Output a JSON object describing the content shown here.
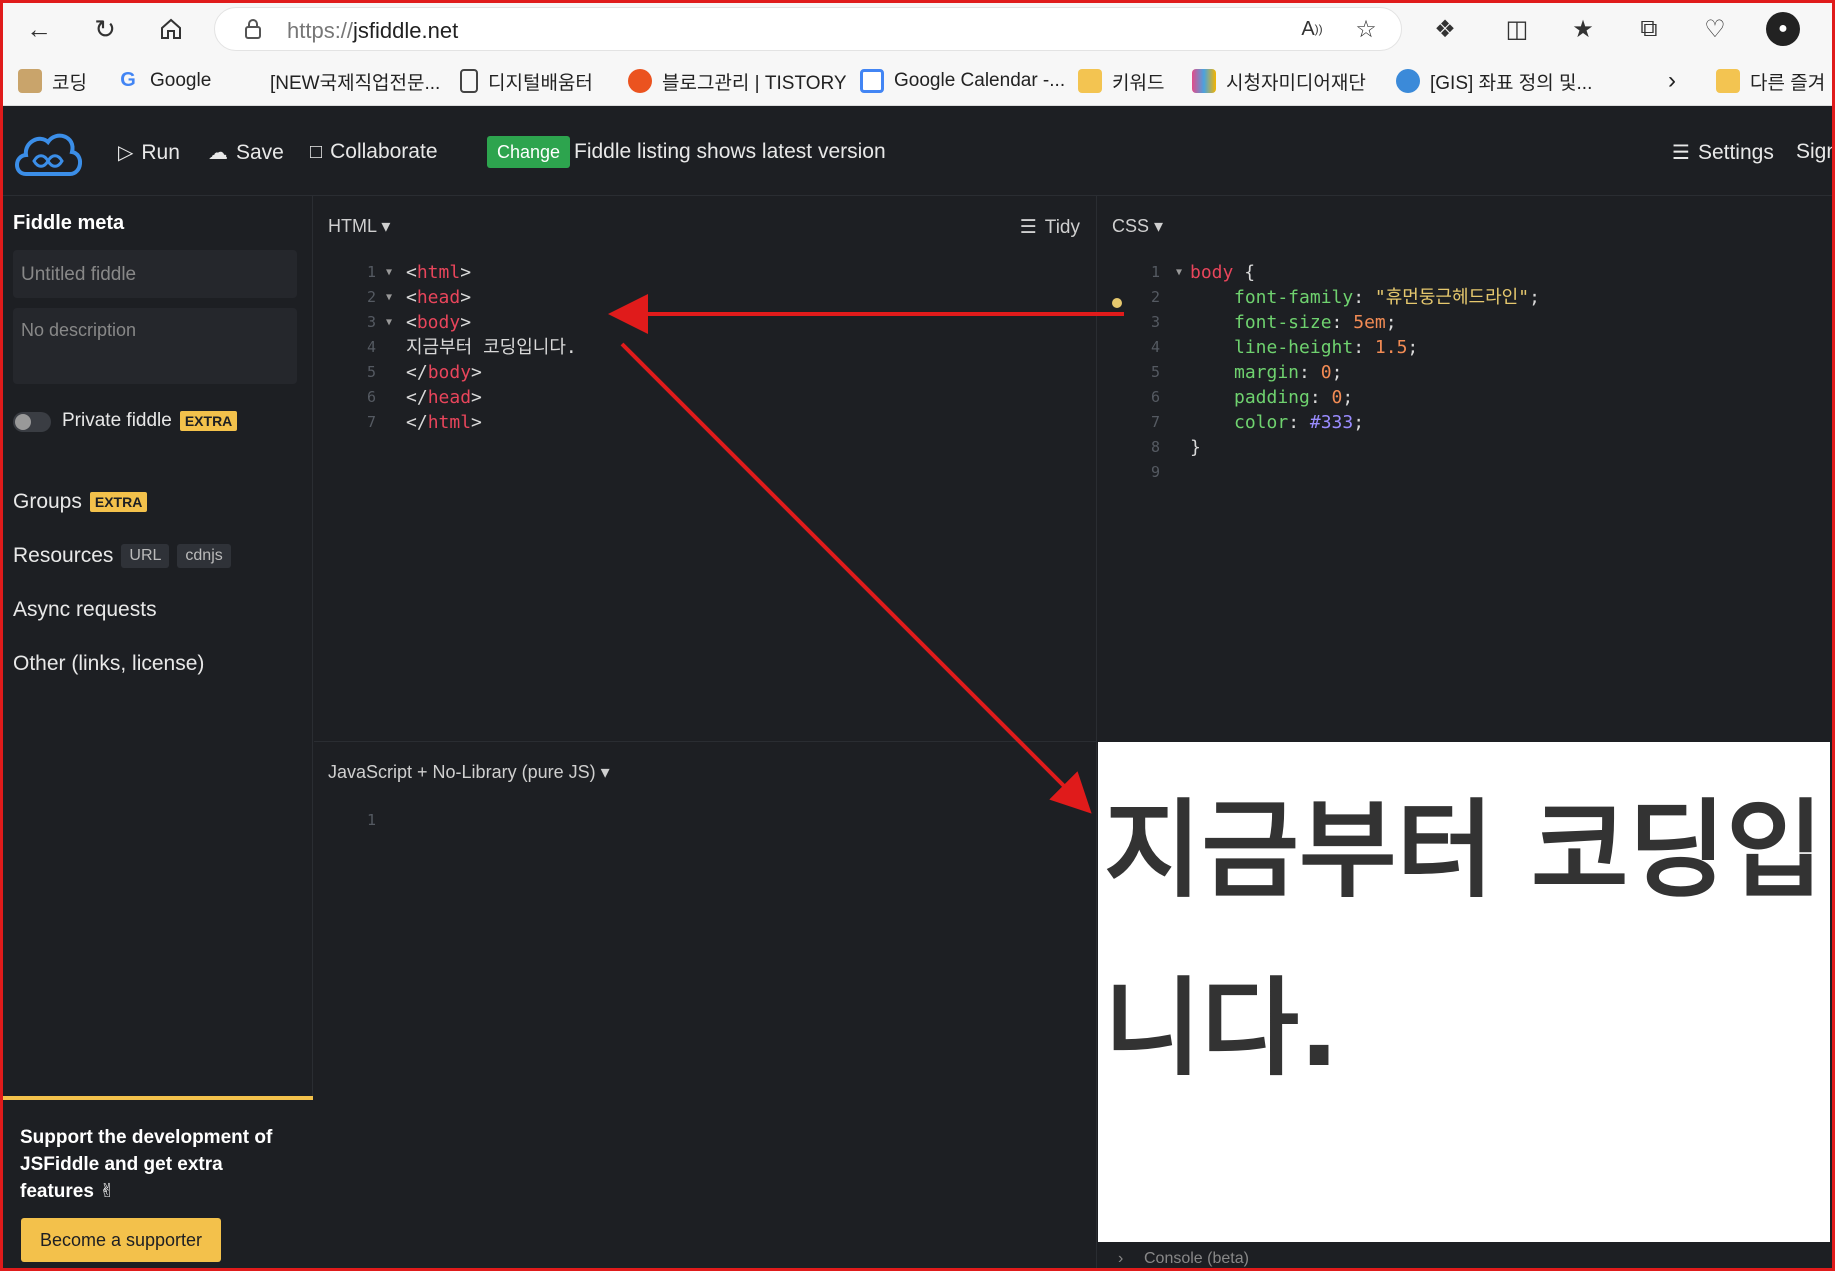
{
  "browser": {
    "url_proto": "https://",
    "url_host": "jsfiddle.net",
    "bookmarks": [
      {
        "label": "코딩",
        "icon": "dog-favicon",
        "color": "#c9a46b"
      },
      {
        "label": "Google",
        "icon": "google-icon",
        "color": "#ffffff"
      },
      {
        "label": "[NEW국제직업전문...",
        "icon": "blank-favicon",
        "color": "#f7f7f7"
      },
      {
        "label": "디지털배움터",
        "icon": "page-icon",
        "color": "#ffffff"
      },
      {
        "label": "블로그관리 | TISTORY",
        "icon": "tistory-icon",
        "color": "#eb531f"
      },
      {
        "label": "Google Calendar -...",
        "icon": "calendar-icon",
        "color": "#4285f4"
      },
      {
        "label": "키워드",
        "icon": "folder-icon",
        "color": "#f3c451"
      },
      {
        "label": "시청자미디어재단",
        "icon": "media-icon",
        "color": "#e34b8a"
      },
      {
        "label": "[GIS] 좌표 정의 및...",
        "icon": "globe-icon",
        "color": "#3b8ad9"
      },
      {
        "label": "다른 즐겨",
        "icon": "folder-icon",
        "color": "#f3c451"
      }
    ]
  },
  "header": {
    "run": "Run",
    "save": "Save",
    "collaborate": "Collaborate",
    "change": "Change",
    "listing": "Fiddle listing shows latest version",
    "settings": "Settings",
    "signin": "Sign"
  },
  "sidebar": {
    "title": "Fiddle meta",
    "name_placeholder": "Untitled fiddle",
    "desc_placeholder": "No description",
    "private": "Private fiddle",
    "extra": "EXTRA",
    "groups": "Groups",
    "resources": "Resources",
    "url_chip": "URL",
    "cdnjs_chip": "cdnjs",
    "async": "Async requests",
    "other": "Other (links, license)",
    "support_text": "Support the development of JSFiddle and get extra features ✌",
    "supporter_btn": "Become a supporter"
  },
  "panels": {
    "html_label": "HTML",
    "tidy": "Tidy",
    "css_label": "CSS",
    "js_label": "JavaScript + No-Library (pure JS)",
    "console": "Console (beta)"
  },
  "html_code": {
    "l1_tag": "html",
    "l2_tag": "head",
    "l3_tag": "body",
    "l4_text": "지금부터 코딩입니다.",
    "l5_tag": "body",
    "l6_tag": "head",
    "l7_tag": "html"
  },
  "css_code": {
    "selector": "body",
    "p1": "font-family",
    "v1": "\"휴먼둥근헤드라인\"",
    "p2": "font-size",
    "v2": "5em",
    "p3": "line-height",
    "v3": "1.5",
    "p4": "margin",
    "v4": "0",
    "p5": "padding",
    "v5": "0",
    "p6": "color",
    "v6": "#333"
  },
  "result": {
    "text": "지금부터 코딩입니다."
  },
  "colors": {
    "annotation": "#e01b1b",
    "accent_yellow": "#f3c14b",
    "change_green": "#2da44e"
  }
}
